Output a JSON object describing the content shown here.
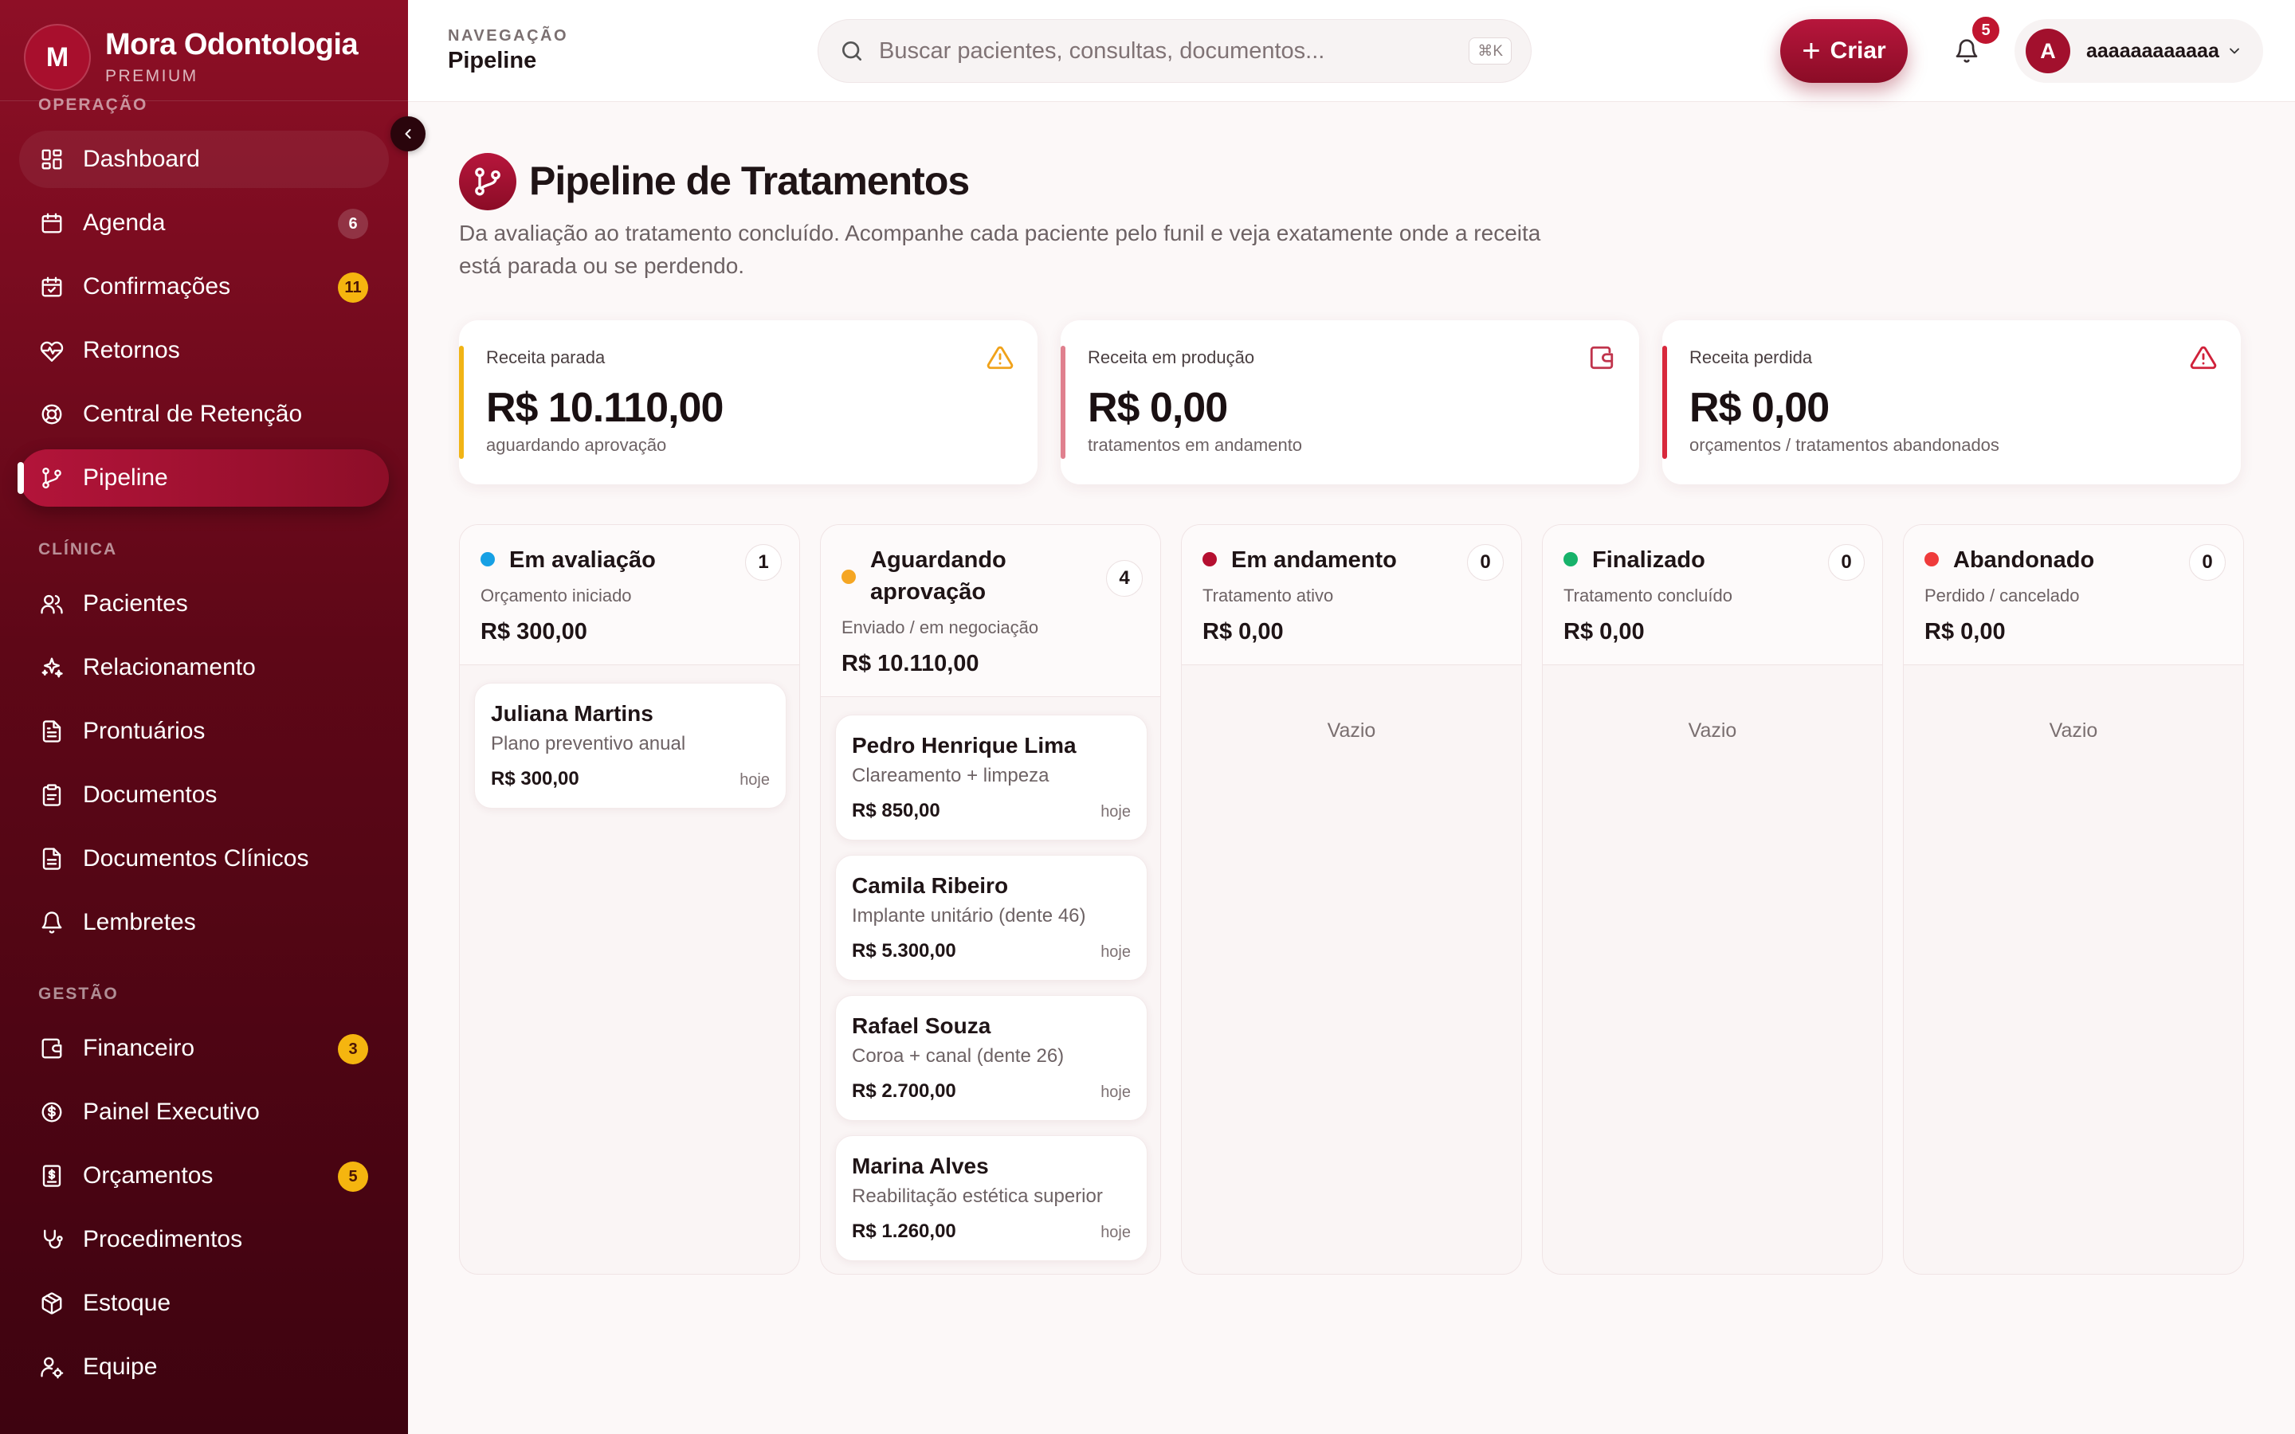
{
  "brand": {
    "logo_letter": "M",
    "name": "Mora Odontologia",
    "tier": "PREMIUM"
  },
  "sidebar": {
    "sections": [
      {
        "label": "OPERAÇÃO"
      },
      {
        "label": "CLÍNICA"
      },
      {
        "label": "GESTÃO"
      }
    ],
    "items": [
      {
        "label": "Dashboard",
        "icon": "grid-icon"
      },
      {
        "label": "Agenda",
        "icon": "calendar-icon",
        "badge": "6"
      },
      {
        "label": "Confirmações",
        "icon": "calendar-check-icon",
        "badge": "11"
      },
      {
        "label": "Retornos",
        "icon": "heart-pulse-icon"
      },
      {
        "label": "Central de Retenção",
        "icon": "lifebuoy-icon"
      },
      {
        "label": "Pipeline",
        "icon": "git-branch-icon",
        "active": true
      },
      {
        "label": "Pacientes",
        "icon": "users-icon"
      },
      {
        "label": "Relacionamento",
        "icon": "sparkles-icon"
      },
      {
        "label": "Prontuários",
        "icon": "file-text-icon"
      },
      {
        "label": "Documentos",
        "icon": "clipboard-icon"
      },
      {
        "label": "Documentos Clínicos",
        "icon": "file-medical-icon"
      },
      {
        "label": "Lembretes",
        "icon": "bell-icon"
      },
      {
        "label": "Financeiro",
        "icon": "wallet-icon",
        "badge": "3"
      },
      {
        "label": "Painel Executivo",
        "icon": "dollar-circle-icon"
      },
      {
        "label": "Orçamentos",
        "icon": "receipt-icon",
        "badge": "5"
      },
      {
        "label": "Procedimentos",
        "icon": "stethoscope-icon"
      },
      {
        "label": "Estoque",
        "icon": "package-icon"
      },
      {
        "label": "Equipe",
        "icon": "user-cog-icon"
      }
    ]
  },
  "header": {
    "crumb_label": "NAVEGAÇÃO",
    "crumb_title": "Pipeline",
    "search_placeholder": "Buscar pacientes, consultas, documentos...",
    "search_shortcut": "⌘K",
    "create_label": "Criar",
    "notifications_count": "5",
    "user_initial": "A",
    "user_name": "aaaaaaaaaaaa"
  },
  "page": {
    "title": "Pipeline de Tratamentos",
    "description": "Da avaliação ao tratamento concluído. Acompanhe cada paciente pelo funil e veja exatamente onde a receita está parada ou se perdendo."
  },
  "kpis": [
    {
      "label": "Receita parada",
      "value": "R$ 10.110,00",
      "sub": "aguardando aprovação",
      "color": "#f1b415",
      "icon": "alert-triangle-icon"
    },
    {
      "label": "Receita em produção",
      "value": "R$ 0,00",
      "sub": "tratamentos em andamento",
      "color": "#e0808e",
      "icon": "wallet-icon"
    },
    {
      "label": "Receita perdida",
      "value": "R$ 0,00",
      "sub": "orçamentos / tratamentos abandonados",
      "color": "#d8283c",
      "icon": "alert-triangle-icon"
    }
  ],
  "columns": [
    {
      "title": "Em avaliação",
      "count": "1",
      "subtitle": "Orçamento iniciado",
      "total": "R$ 300,00",
      "color": "#17a0e4",
      "cards": [
        {
          "name": "Juliana Martins",
          "desc": "Plano preventivo anual",
          "value": "R$ 300,00",
          "date": "hoje"
        }
      ]
    },
    {
      "title": "Aguardando aprovação",
      "count": "4",
      "subtitle": "Enviado / em negociação",
      "total": "R$ 10.110,00",
      "color": "#f5a623",
      "cards": [
        {
          "name": "Pedro Henrique Lima",
          "desc": "Clareamento + limpeza",
          "value": "R$ 850,00",
          "date": "hoje"
        },
        {
          "name": "Camila Ribeiro",
          "desc": "Implante unitário (dente 46)",
          "value": "R$ 5.300,00",
          "date": "hoje"
        },
        {
          "name": "Rafael Souza",
          "desc": "Coroa + canal (dente 26)",
          "value": "R$ 2.700,00",
          "date": "hoje"
        },
        {
          "name": "Marina Alves",
          "desc": "Reabilitação estética superior",
          "value": "R$ 1.260,00",
          "date": "hoje"
        }
      ]
    },
    {
      "title": "Em andamento",
      "count": "0",
      "subtitle": "Tratamento ativo",
      "total": "R$ 0,00",
      "color": "#b50f30",
      "empty": "Vazio",
      "cards": []
    },
    {
      "title": "Finalizado",
      "count": "0",
      "subtitle": "Tratamento concluído",
      "total": "R$ 0,00",
      "color": "#17b26a",
      "empty": "Vazio",
      "cards": []
    },
    {
      "title": "Abandonado",
      "count": "0",
      "subtitle": "Perdido / cancelado",
      "total": "R$ 0,00",
      "color": "#ef3b3b",
      "empty": "Vazio",
      "cards": []
    }
  ]
}
